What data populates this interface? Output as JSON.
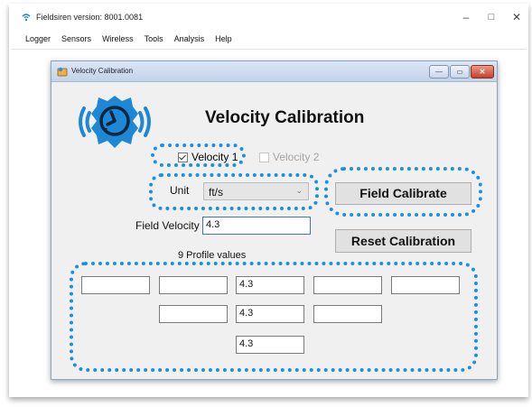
{
  "app": {
    "title": "Fieldsiren version: 8001.0081"
  },
  "window_controls": {
    "minimize": "–",
    "maximize": "□",
    "close": "✕"
  },
  "menu": [
    "Logger",
    "Sensors",
    "Wireless",
    "Tools",
    "Analysis",
    "Help"
  ],
  "dialog": {
    "title": "Velocity Calibration",
    "controls": {
      "minimize": "—",
      "maximize": "▭",
      "close": "✕"
    },
    "heading": "Velocity Calibration",
    "velocity1": {
      "label": "Velocity 1",
      "checked": true
    },
    "velocity2": {
      "label": "Velocity 2",
      "checked": false,
      "enabled": false
    },
    "unit": {
      "label": "Unit",
      "value": "ft/s"
    },
    "field_calibrate_label": "Field Calibrate",
    "field_velocity": {
      "label": "Field Velocity",
      "value": "4.3"
    },
    "reset_calibration_label": "Reset Calibration",
    "profile": {
      "label": "9 Profile values",
      "row1": [
        "",
        "",
        "4.3",
        "",
        ""
      ],
      "row2": [
        "",
        "4.3",
        ""
      ],
      "row3": [
        "4.3"
      ]
    }
  },
  "colors": {
    "highlight": "#1d8fe0",
    "logo_blue": "#1e88d6"
  }
}
